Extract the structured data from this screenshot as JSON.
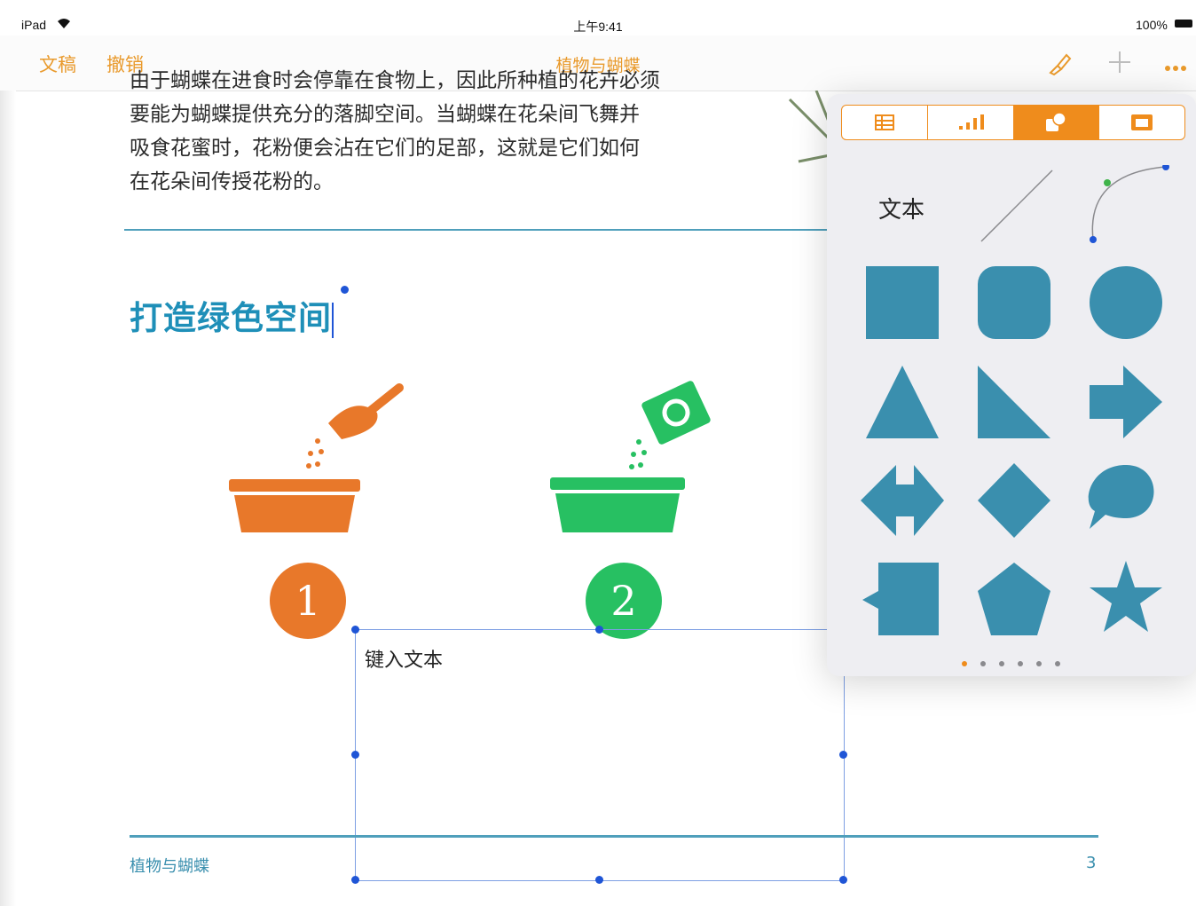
{
  "status": {
    "device": "iPad",
    "time": "上午9:41",
    "battery": "100%"
  },
  "nav": {
    "documents_label": "文稿",
    "undo_label": "撤销",
    "title": "植物与蝴蝶"
  },
  "body": {
    "line0": "由于蝴蝶在进食时会停靠在食物上，因此所种植的花卉必须",
    "line1": "要能为蝴蝶提供充分的落脚空间。当蝴蝶在花朵间飞舞并",
    "line2": "吸食花蜜时，花粉便会沾在它们的足部，这就是它们如何",
    "line3": "在花朵间传授花粉的。"
  },
  "heading": "打造绿色空间",
  "steps": [
    {
      "number": "1",
      "color": "#e8782a"
    },
    {
      "number": "2",
      "color": "#27c062"
    }
  ],
  "textbox": {
    "placeholder": "键入文本"
  },
  "footer": {
    "title": "植物与蝴蝶",
    "page": "3"
  },
  "shapes_popover": {
    "tabs": [
      "table-icon",
      "chart-icon",
      "shapes-icon",
      "media-icon"
    ],
    "selected_tab": 2,
    "text_item_label": "文本",
    "shape_color": "#3a8fae",
    "shapes": [
      "square",
      "rounded-square",
      "circle",
      "triangle",
      "right-triangle",
      "arrow-right",
      "double-arrow",
      "diamond",
      "speech-bubble",
      "callout-square",
      "pentagon",
      "star"
    ],
    "pages": 6,
    "current_page": 1
  },
  "colors": {
    "accent": "#e99a2c",
    "heading": "#1e8fb8",
    "rule": "#4f9fbb"
  }
}
